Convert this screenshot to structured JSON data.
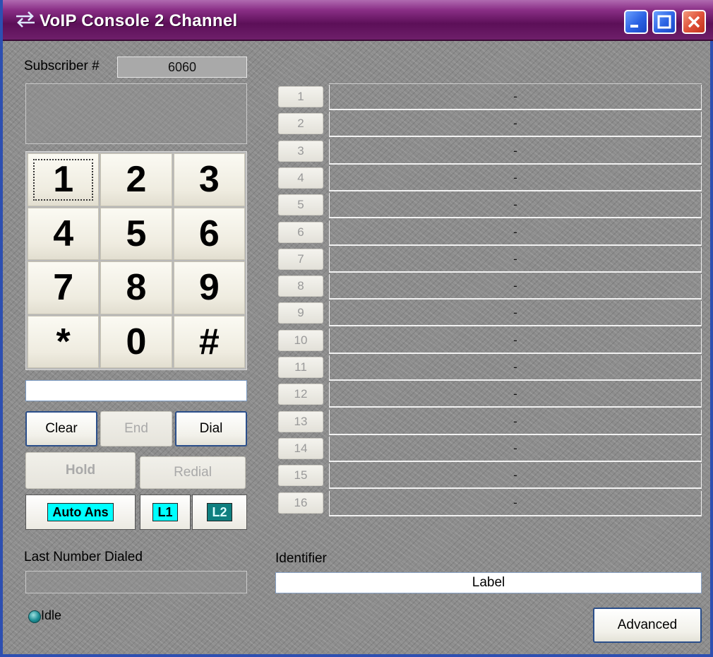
{
  "window": {
    "title": "VoIP Console 2 Channel"
  },
  "subscriber": {
    "label": "Subscriber #",
    "value": "6060"
  },
  "keypad": {
    "keys": [
      "1",
      "2",
      "3",
      "4",
      "5",
      "6",
      "7",
      "8",
      "9",
      "*",
      "0",
      "#"
    ]
  },
  "buttons": {
    "clear": "Clear",
    "end": "End",
    "dial": "Dial",
    "hold": "Hold",
    "redial": "Redial",
    "auto_ans": "Auto Ans",
    "l1": "L1",
    "l2": "L2",
    "advanced": "Advanced"
  },
  "channels": [
    {
      "num": "1",
      "text": "-"
    },
    {
      "num": "2",
      "text": "-"
    },
    {
      "num": "3",
      "text": "-"
    },
    {
      "num": "4",
      "text": "-"
    },
    {
      "num": "5",
      "text": "-"
    },
    {
      "num": "6",
      "text": "-"
    },
    {
      "num": "7",
      "text": "-"
    },
    {
      "num": "8",
      "text": "-"
    },
    {
      "num": "9",
      "text": "-"
    },
    {
      "num": "10",
      "text": "-"
    },
    {
      "num": "11",
      "text": "-"
    },
    {
      "num": "12",
      "text": "-"
    },
    {
      "num": "13",
      "text": "-"
    },
    {
      "num": "14",
      "text": "-"
    },
    {
      "num": "15",
      "text": "-"
    },
    {
      "num": "16",
      "text": "-"
    }
  ],
  "last_number": {
    "label": "Last Number Dialed",
    "value": ""
  },
  "identifier": {
    "label": "Identifier",
    "value": "Label"
  },
  "status": {
    "text": "Idle"
  },
  "colors": {
    "title_gradient_mid": "#8a2f86",
    "auto_ans_cyan": "#00ffff",
    "l2_teal": "#0f7f7f",
    "button_border": "#2a4e8a"
  }
}
